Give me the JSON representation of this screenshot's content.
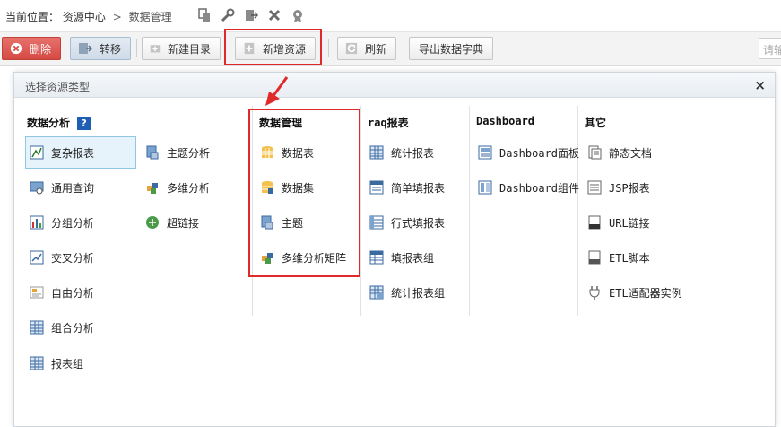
{
  "breadcrumb": {
    "prefix": "当前位置：",
    "root": "资源中心",
    "separator": ">",
    "current": "数据管理"
  },
  "toolbar": {
    "delete": "删除",
    "move": "转移",
    "new_dir": "新建目录",
    "new_resource": "新增资源",
    "refresh": "刷新",
    "export_dict": "导出数据字典",
    "search_placeholder": "请输"
  },
  "dialog": {
    "title": "选择资源类型",
    "close": "×",
    "help": "?",
    "columns": {
      "analysis": {
        "title": "数据分析",
        "items_left": [
          "复杂报表",
          "通用查询",
          "分组分析",
          "交叉分析",
          "自由分析",
          "组合分析",
          "报表组"
        ],
        "items_right": [
          "主题分析",
          "多维分析",
          "超链接"
        ]
      },
      "data_mgmt": {
        "title": "数据管理",
        "items": [
          "数据表",
          "数据集",
          "主题",
          "多维分析矩阵"
        ]
      },
      "raq": {
        "title": "raq报表",
        "items": [
          "统计报表",
          "简单填报表",
          "行式填报表",
          "填报表组",
          "统计报表组"
        ]
      },
      "dashboard": {
        "title": "Dashboard",
        "items": [
          "Dashboard面板",
          "Dashboard组件"
        ]
      },
      "other": {
        "title": "其它",
        "items": [
          "静态文档",
          "JSP报表",
          "URL链接",
          "ETL脚本",
          "ETL适配器实例"
        ]
      }
    }
  },
  "colors": {
    "highlight": "#e02a2a",
    "delete_button": "#d44a44",
    "selected_bg": "#e6f3fb",
    "help_icon": "#1f5fb3"
  }
}
